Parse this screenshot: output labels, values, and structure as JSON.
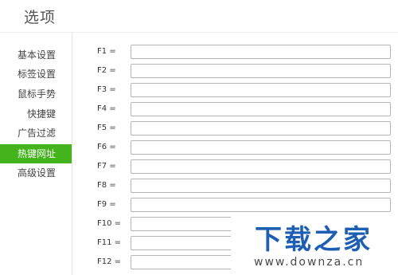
{
  "window": {
    "title": "选项"
  },
  "sidebar": {
    "items": [
      {
        "label": "基本设置",
        "active": false
      },
      {
        "label": "标签设置",
        "active": false
      },
      {
        "label": "鼠标手势",
        "active": false
      },
      {
        "label": "快捷键",
        "active": false
      },
      {
        "label": "广告过滤",
        "active": false
      },
      {
        "label": "热键网址",
        "active": true
      },
      {
        "label": "高级设置",
        "active": false
      }
    ]
  },
  "hotkeys": [
    {
      "label": "F1 =",
      "value": ""
    },
    {
      "label": "F2 =",
      "value": ""
    },
    {
      "label": "F3 =",
      "value": ""
    },
    {
      "label": "F4 =",
      "value": ""
    },
    {
      "label": "F5 =",
      "value": ""
    },
    {
      "label": "F6 =",
      "value": ""
    },
    {
      "label": "F7 =",
      "value": ""
    },
    {
      "label": "F8 =",
      "value": ""
    },
    {
      "label": "F9 =",
      "value": ""
    },
    {
      "label": "F10 =",
      "value": ""
    },
    {
      "label": "F11 =",
      "value": ""
    },
    {
      "label": "F12 =",
      "value": ""
    }
  ],
  "watermark": {
    "logo": "下载之家",
    "url": "www.downza.cn"
  },
  "colors": {
    "active_tab": "#43b41c",
    "watermark_logo": "#1e5fb3"
  }
}
